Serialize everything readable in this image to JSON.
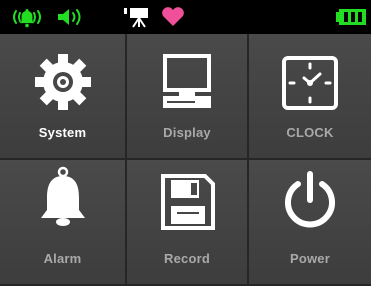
{
  "status_bar": {
    "icons": [
      {
        "name": "alarm-ringing-icon",
        "color": "#22dd22"
      },
      {
        "name": "speaker-volume-icon",
        "color": "#22dd22"
      },
      {
        "name": "camera-icon",
        "color": "#ffffff"
      },
      {
        "name": "heart-icon",
        "color": "#f0509a"
      }
    ],
    "battery": {
      "name": "battery-icon",
      "color": "#22dd22",
      "level": 1.0
    }
  },
  "menu": {
    "tiles": [
      {
        "label": "System",
        "icon": "gear-icon",
        "selected": true
      },
      {
        "label": "Display",
        "icon": "monitor-icon",
        "selected": false
      },
      {
        "label": "CLOCK",
        "icon": "clock-icon",
        "selected": false
      },
      {
        "label": "Alarm",
        "icon": "bell-icon",
        "selected": false
      },
      {
        "label": "Record",
        "icon": "floppy-disk-icon",
        "selected": false
      },
      {
        "label": "Power",
        "icon": "power-icon",
        "selected": false
      }
    ]
  },
  "colors": {
    "accent_green": "#22dd22",
    "heart_pink": "#f0509a",
    "tile_bg": "#444444",
    "label_selected": "#ffffff",
    "label_normal": "#a9a9a9"
  }
}
